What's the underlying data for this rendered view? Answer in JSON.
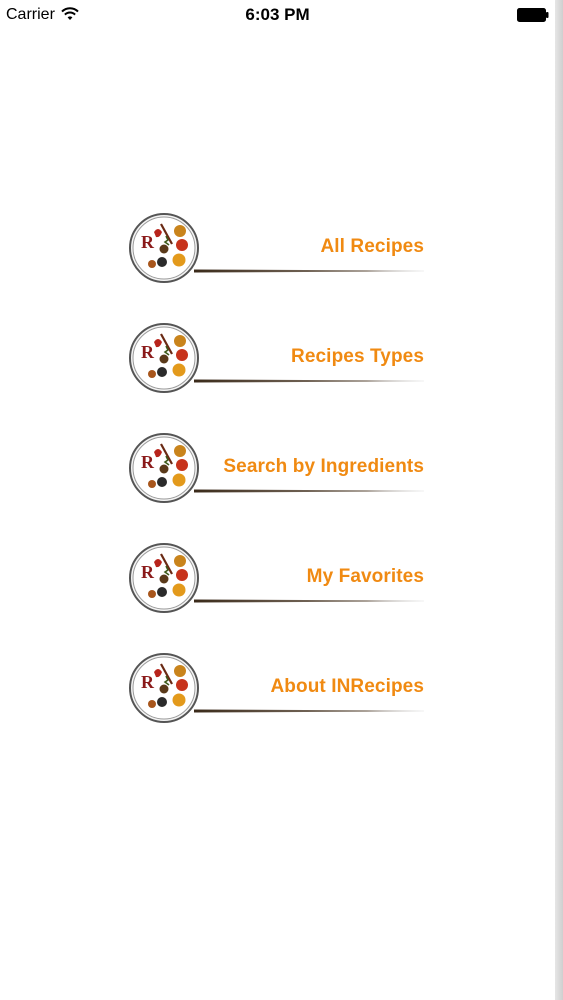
{
  "status_bar": {
    "carrier": "Carrier",
    "time": "6:03 PM",
    "wifi_icon": "wifi-icon",
    "battery_icon": "battery-icon"
  },
  "menu": {
    "accent_color": "#f08a12",
    "items": [
      {
        "label": "All Recipes",
        "icon": "spice-plate-icon"
      },
      {
        "label": "Recipes Types",
        "icon": "spice-plate-icon"
      },
      {
        "label": "Search by Ingredients",
        "icon": "spice-plate-icon"
      },
      {
        "label": "My Favorites",
        "icon": "spice-plate-icon"
      },
      {
        "label": "About INRecipes",
        "icon": "spice-plate-icon"
      }
    ]
  }
}
